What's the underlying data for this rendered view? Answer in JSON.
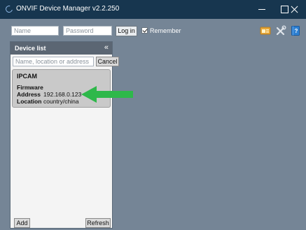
{
  "window": {
    "title": "ONVIF Device Manager v2.2.250"
  },
  "login": {
    "name_placeholder": "Name",
    "password_placeholder": "Password",
    "login_label": "Log in",
    "remember_label": "Remember",
    "remember_checked": true
  },
  "toolbar": {
    "icons": [
      "badge-icon",
      "tools-icon",
      "help-book-icon"
    ]
  },
  "device_list": {
    "title": "Device list",
    "collapse_glyph": "«",
    "search_placeholder": "Name, location or address",
    "cancel_label": "Cancel",
    "add_label": "Add",
    "refresh_label": "Refresh",
    "devices": [
      {
        "name": "IPCAM",
        "firmware_label": "Firmware",
        "firmware": "",
        "address_label": "Address",
        "address": "192.168.0.123",
        "location_label": "Location",
        "location": "country/china"
      }
    ]
  },
  "colors": {
    "titlebar": "#17364f",
    "background": "#758596",
    "panel_header": "#5b6673",
    "annotation_arrow": "#2eb84a"
  }
}
